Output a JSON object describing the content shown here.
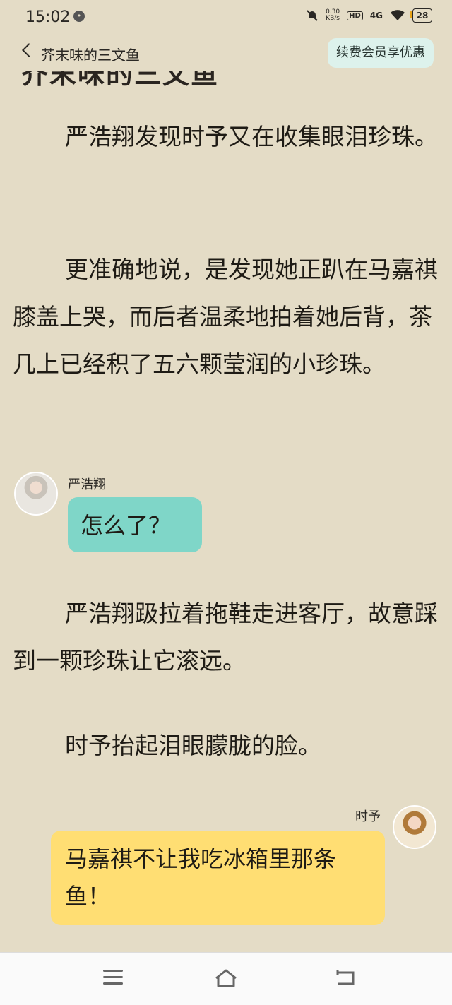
{
  "status": {
    "time": "15:02",
    "net_speed": "0.30\nKB/s",
    "hd": "HD",
    "signal": "4G",
    "battery": "28"
  },
  "nav": {
    "title": "芥末味的三文鱼",
    "vip_button": "续费会员享优惠",
    "cut_title": "芥末味的三文鱼"
  },
  "content": {
    "p1": "严浩翔发现时予又在收集眼泪珍珠。",
    "p2": "更准确地说，是发现她正趴在马嘉祺膝盖上哭，而后者温柔地拍着她后背，茶几上已经积了五六颗莹润的小珍珠。",
    "chat1": {
      "speaker": "严浩翔",
      "text": "怎么了？"
    },
    "p3": "严浩翔趿拉着拖鞋走进客厅，故意踩到一颗珍珠让它滚远。",
    "p4": "时予抬起泪眼朦胧的脸。",
    "chat2": {
      "speaker": "时予",
      "text": "马嘉祺不让我吃冰箱里那条鱼！"
    }
  },
  "icons": {
    "menu": "menu-icon",
    "home": "home-icon",
    "back": "back-icon"
  }
}
